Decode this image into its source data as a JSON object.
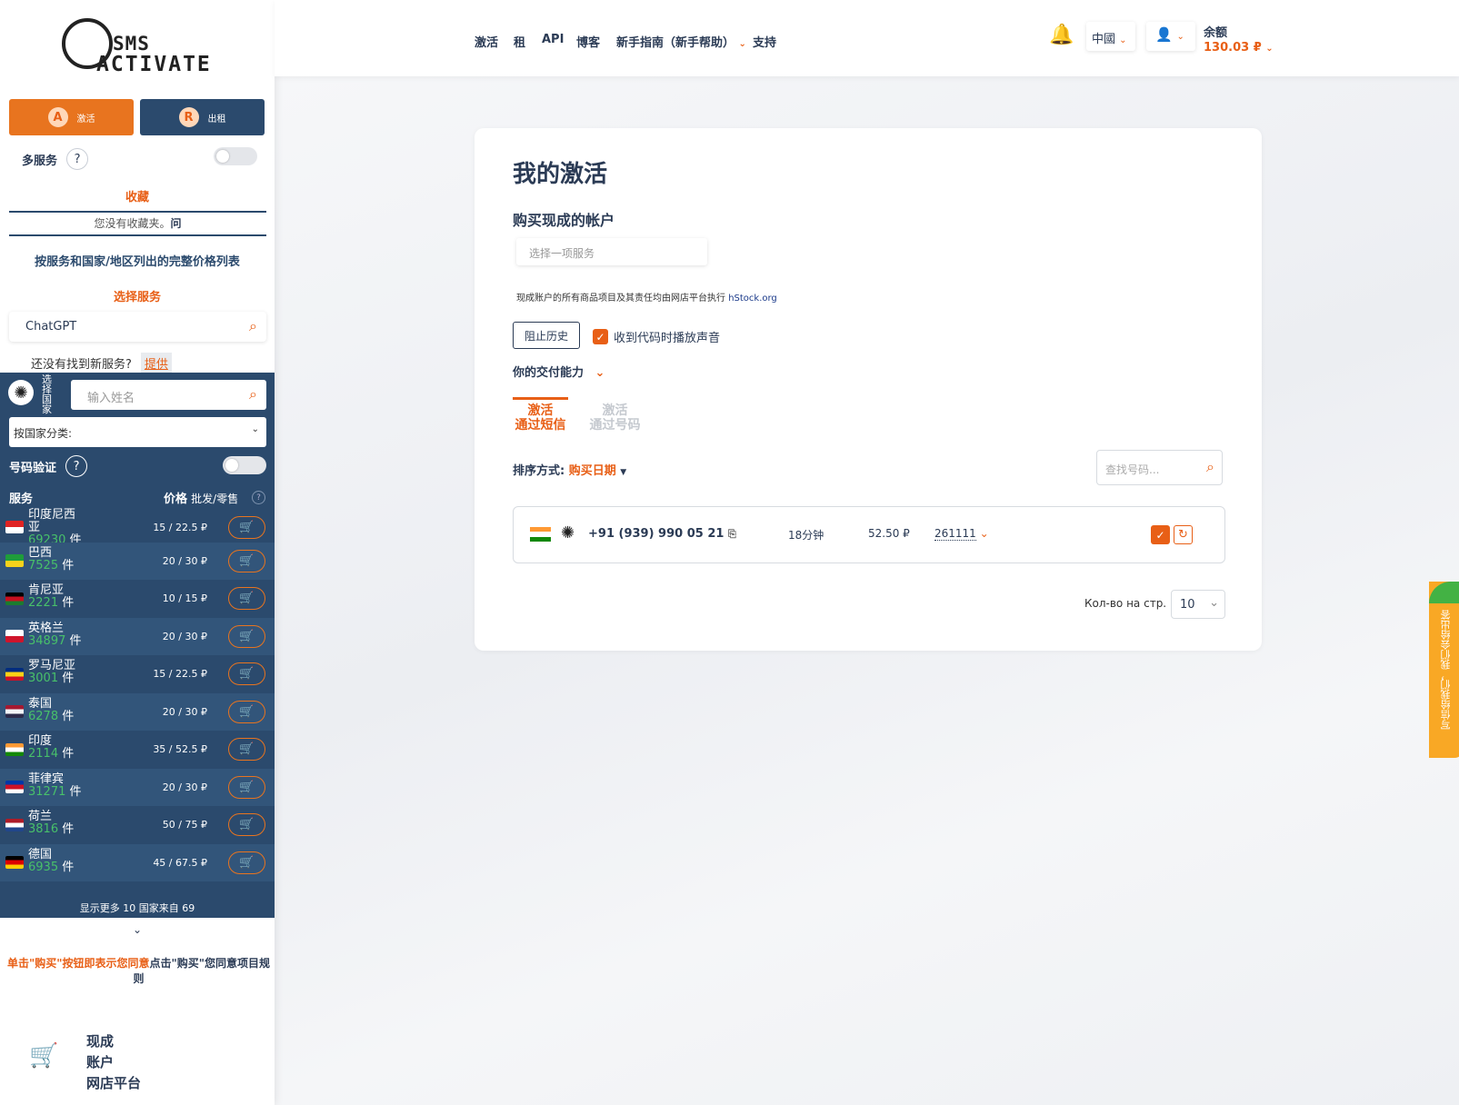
{
  "logo": {
    "line1": "SMS",
    "line2": "ACTIVATE"
  },
  "modes": {
    "activate": "激活",
    "rent": "出租"
  },
  "multi_service": {
    "label": "多服务",
    "help": "?"
  },
  "favorites": {
    "title": "收藏",
    "empty": "您没有收藏夹。",
    "q": "问"
  },
  "price_list_link": "按服务和国家/地区列出的完整价格列表",
  "select_service": {
    "title": "选择服务",
    "value": "ChatGPT"
  },
  "not_found": {
    "text": "还没有找到新服务?",
    "link": "提供"
  },
  "country_select": {
    "label": "选择国家",
    "placeholder": "输入姓名",
    "category": "按国家分类:"
  },
  "number_verify": {
    "label": "号码验证",
    "help": "?"
  },
  "table_header": {
    "service": "服务",
    "price": "价格",
    "wholesale": "批发/零售",
    "help": "?"
  },
  "unit": "件",
  "countries": [
    {
      "name": "印度尼西亚",
      "count": "69230",
      "price": "15 / 22.5 ₽",
      "flag": [
        "#e02323",
        "#ffffff"
      ]
    },
    {
      "name": "巴西",
      "count": "7525",
      "price": "20 / 30 ₽",
      "flag": [
        "#1f9d3a",
        "#f7d21b"
      ]
    },
    {
      "name": "肯尼亚",
      "count": "2221",
      "price": "10 / 15 ₽",
      "flag": [
        "#000000",
        "#c7101f",
        "#1b7c2f"
      ]
    },
    {
      "name": "英格兰",
      "count": "34897",
      "price": "20 / 30 ₽",
      "flag": [
        "#ffffff",
        "#cf142b"
      ]
    },
    {
      "name": "罗马尼亚",
      "count": "3001",
      "price": "15 / 22.5 ₽",
      "flag": [
        "#002b7f",
        "#fcd116",
        "#ce1126"
      ]
    },
    {
      "name": "泰国",
      "count": "6278",
      "price": "20 / 30 ₽",
      "flag": [
        "#a51931",
        "#f4f5f8",
        "#2d2a4a"
      ]
    },
    {
      "name": "印度",
      "count": "2114",
      "price": "35 / 52.5 ₽",
      "flag": [
        "#ff9933",
        "#ffffff",
        "#138808"
      ]
    },
    {
      "name": "菲律宾",
      "count": "31271",
      "price": "20 / 30 ₽",
      "flag": [
        "#0038a8",
        "#ce1126",
        "#ffffff"
      ]
    },
    {
      "name": "荷兰",
      "count": "3816",
      "price": "50 / 75 ₽",
      "flag": [
        "#ae1c28",
        "#ffffff",
        "#21468b"
      ]
    },
    {
      "name": "德国",
      "count": "6935",
      "price": "45 / 67.5 ₽",
      "flag": [
        "#000000",
        "#dd0000",
        "#ffce00"
      ]
    }
  ],
  "show_more": "显示更多 10 国家来自 69",
  "agree": {
    "orange": "单击\"购买\"按钮即表示您同意",
    "rest": "点击\"购买\"您同意项目规则"
  },
  "marketplace": {
    "l1": "现成",
    "l2": "账户",
    "l3": "网店平台"
  },
  "nav": {
    "activate": "激活",
    "rent": "租",
    "api": "API",
    "blog": "博客",
    "guide": "新手指南（新手帮助）",
    "support": "支持"
  },
  "header": {
    "lang": "中國",
    "balance_label": "余额",
    "balance": "130.03 ₽"
  },
  "card": {
    "title": "我的激活",
    "buy_title": "购买现成的帐户",
    "service_placeholder": "选择一项服务",
    "note": "现成账户的所有商品项目及其责任均由网店平台执行",
    "note_link": "hStock.org",
    "block_history": "阻止历史",
    "sound": "收到代码时播放声音",
    "delivery": "你的交付能力",
    "tab1a": "激活",
    "tab1b": "通过短信",
    "tab2a": "激活",
    "tab2b": "通过号码",
    "sort_label": "排序方式:",
    "sort_value": "购买日期",
    "search_placeholder": "查找号码...",
    "activation": {
      "phone": "+91 (939) 990 05 21",
      "time": "18分钟",
      "price": "52.50 ₽",
      "code": "261111"
    },
    "per_page_label": "Кол-во на стр.",
    "per_page": "10"
  },
  "feedback": "写信给我们，我们会给出答",
  "colors": {
    "accent": "#e85f16",
    "dark": "#2b4a6d",
    "navy": "#2b3b55"
  }
}
